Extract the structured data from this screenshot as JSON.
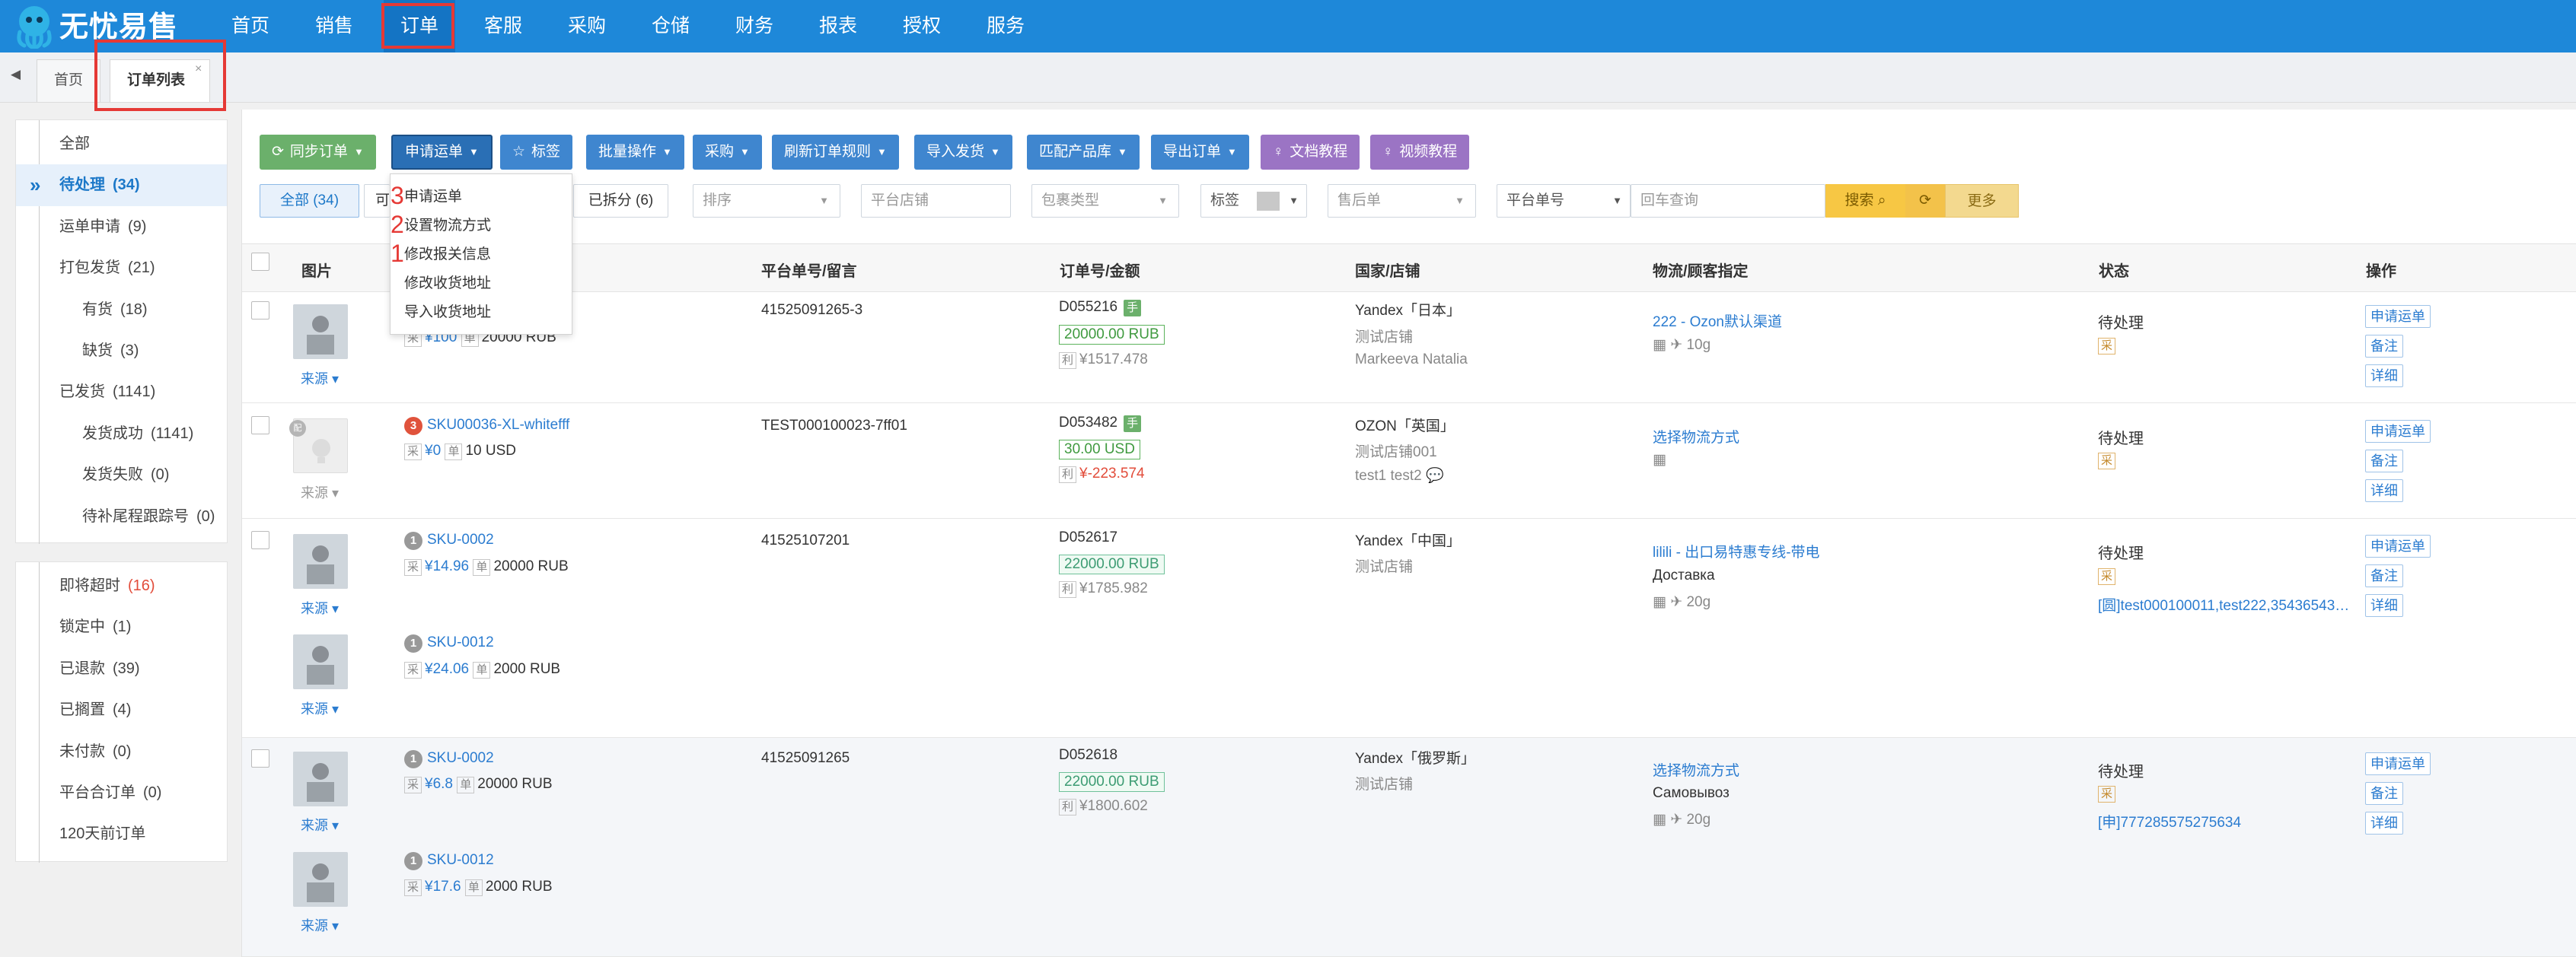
{
  "app": {
    "name": "无忧易售"
  },
  "topnav": {
    "items": [
      "首页",
      "销售",
      "订单",
      "客服",
      "采购",
      "仓储",
      "财务",
      "报表",
      "授权",
      "服务"
    ]
  },
  "tabs": [
    {
      "label": "首页"
    },
    {
      "label": "订单列表",
      "close": "×"
    }
  ],
  "sidebar": {
    "group1": [
      {
        "label": "全部",
        "count": ""
      },
      {
        "label": "待处理",
        "count": "(34)"
      },
      {
        "label": "运单申请",
        "count": "(9)"
      },
      {
        "label": "打包发货",
        "count": "(21)"
      },
      {
        "label": "有货",
        "count": "(18)"
      },
      {
        "label": "缺货",
        "count": "(3)"
      },
      {
        "label": "已发货",
        "count": "(1141)"
      },
      {
        "label": "发货成功",
        "count": "(1141)"
      },
      {
        "label": "发货失败",
        "count": "(0)"
      },
      {
        "label": "待补尾程跟踪号",
        "count": "(0)"
      }
    ],
    "group2": [
      {
        "label": "即将超时",
        "count": "(16)"
      },
      {
        "label": "锁定中",
        "count": "(1)"
      },
      {
        "label": "已退款",
        "count": "(39)"
      },
      {
        "label": "已搁置",
        "count": "(4)"
      },
      {
        "label": "未付款",
        "count": "(0)"
      },
      {
        "label": "平台合订单",
        "count": "(0)"
      },
      {
        "label": "120天前订单",
        "count": ""
      }
    ]
  },
  "toolbar": {
    "sync": "同步订单",
    "apply_waybill": "申请运单",
    "tag": "标签",
    "batch": "批量操作",
    "purchase": "采购",
    "refresh_rule": "刷新订单规则",
    "import_ship": "导入发货",
    "match_product": "匹配产品库",
    "export": "导出订单",
    "doc_tutorial": "文档教程",
    "video_tutorial": "视频教程"
  },
  "dropdown": {
    "items": [
      {
        "num": "3",
        "label": "申请运单"
      },
      {
        "num": "2",
        "label": "设置物流方式"
      },
      {
        "num": "1",
        "label": "修改报关信息"
      },
      {
        "num": "",
        "label": "修改收货地址"
      },
      {
        "num": "",
        "label": "导入收货地址"
      }
    ]
  },
  "filters": {
    "all": "全部 (34)",
    "partial": "可",
    "split": "已拆分 (6)",
    "sort": "排序",
    "shop": "平台店铺",
    "package": "包裹类型",
    "tag": "标签",
    "aftersale": "售后单",
    "platform_no": "平台单号",
    "search_placeholder": "回车查询",
    "search": "搜索",
    "more": "更多"
  },
  "columns": [
    "图片",
    "平台单号/留言",
    "订单号/金额",
    "国家/店铺",
    "物流/顾客指定",
    "状态",
    "操作"
  ],
  "orders": [
    {
      "platform_no": "41525091265-3",
      "items": [
        {
          "num": "",
          "sku": "",
          "buy_tag": "采",
          "price": "¥100",
          "unit_tag": "单",
          "unit_price": "20000 RUB",
          "source": "来源"
        }
      ],
      "order_no": "D055216",
      "order_tag": "手",
      "amount": "20000.00 RUB",
      "profit_tag": "利",
      "profit": "¥1517.478",
      "country_shop": "Yandex「日本」",
      "shop": "测试店铺",
      "buyer": "Markeeva Natalia",
      "logistics": "222 - Ozon默认渠道",
      "carrier": "",
      "weight": "10g",
      "status": "待处理",
      "status_tag": "采",
      "tracking": "",
      "ops": [
        "申请运单",
        "备注",
        "详细"
      ]
    },
    {
      "platform_no": "TEST000100023-7ff01",
      "items": [
        {
          "num": "3",
          "sku": "SKU00036-XL-whitefff",
          "buy_tag": "采",
          "price": "¥0",
          "unit_tag": "单",
          "unit_price": "10 USD",
          "source": "来源"
        }
      ],
      "order_no": "D053482",
      "order_tag": "手",
      "amount": "30.00 USD",
      "profit_tag": "利",
      "profit": "¥-223.574",
      "country_shop": "OZON「英国」",
      "shop": "测试店铺001",
      "buyer": "test1 test2",
      "logistics": "选择物流方式",
      "carrier": "",
      "weight": "",
      "status": "待处理",
      "status_tag": "采",
      "tracking": "",
      "ops": [
        "申请运单",
        "备注",
        "详细"
      ]
    },
    {
      "platform_no": "41525107201",
      "items": [
        {
          "num": "1",
          "sku": "SKU-0002",
          "buy_tag": "采",
          "price": "¥14.96",
          "unit_tag": "单",
          "unit_price": "20000 RUB",
          "source": "来源"
        },
        {
          "num": "1",
          "sku": "SKU-0012",
          "buy_tag": "采",
          "price": "¥24.06",
          "unit_tag": "单",
          "unit_price": "2000 RUB",
          "source": "来源"
        }
      ],
      "order_no": "D052617",
      "order_tag": "",
      "amount": "22000.00 RUB",
      "profit_tag": "利",
      "profit": "¥1785.982",
      "country_shop": "Yandex「中国」",
      "shop": "测试店铺",
      "buyer": "",
      "logistics": "lilili - 出口易特惠专线-带电",
      "carrier": "Доставка",
      "weight": "20g",
      "status": "待处理",
      "status_tag": "采",
      "tracking": "[圆]test000100011,test222,35436543…",
      "ops": [
        "申请运单",
        "备注",
        "详细"
      ]
    },
    {
      "platform_no": "41525091265",
      "items": [
        {
          "num": "1",
          "sku": "SKU-0002",
          "buy_tag": "采",
          "price": "¥6.8",
          "unit_tag": "单",
          "unit_price": "20000 RUB",
          "source": "来源"
        },
        {
          "num": "1",
          "sku": "SKU-0012",
          "buy_tag": "采",
          "price": "¥17.6",
          "unit_tag": "单",
          "unit_price": "2000 RUB",
          "source": "来源"
        }
      ],
      "order_no": "D052618",
      "order_tag": "",
      "amount": "22000.00 RUB",
      "profit_tag": "利",
      "profit": "¥1800.602",
      "country_shop": "Yandex「俄罗斯」",
      "shop": "测试店铺",
      "buyer": "",
      "logistics": "选择物流方式",
      "carrier": "Самовывоз",
      "weight": "20g",
      "status": "待处理",
      "status_tag": "采",
      "tracking": "[申]777285575275634",
      "ops": [
        "申请运单",
        "备注",
        "详细"
      ]
    }
  ],
  "colors": {
    "nav": "#1e88d9",
    "highlight": "#e53935",
    "link": "#2b7cd0",
    "green": "#6bb06b",
    "purple": "#9b74c4"
  }
}
